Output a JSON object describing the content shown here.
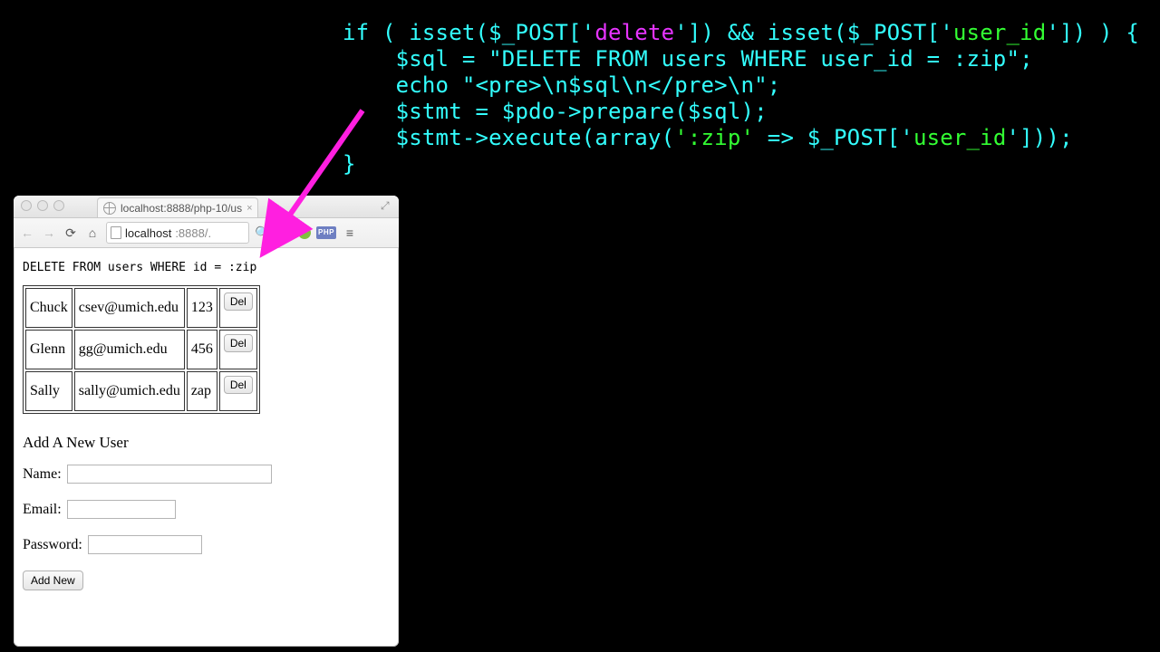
{
  "code": {
    "line1_pre": "if ( isset($_POST['",
    "line1_del": "delete",
    "line1_mid": "']) && isset($_POST['",
    "line1_uid": "user_id",
    "line1_post": "']) ) {",
    "line2": "    $sql = \"DELETE FROM users WHERE user_id = :zip\";",
    "line3": "    echo \"<pre>\\n$sql\\n</pre>\\n\";",
    "line4": "    $stmt = $pdo->prepare($sql);",
    "line5_pre": "    $stmt->execute(array(",
    "line5_zip": "':zip'",
    "line5_mid": " => $_POST['",
    "line5_uid": "user_id",
    "line5_post": "']));",
    "line6": "}"
  },
  "browser": {
    "tab_title": "localhost:8888/php-10/us",
    "address_host": "localhost",
    "address_port": ":8888/.",
    "php_badge": "PHP"
  },
  "page": {
    "sql_echo": "DELETE FROM users WHERE id = :zip",
    "users": [
      {
        "name": "Chuck",
        "email": "csev@umich.edu",
        "pw": "123"
      },
      {
        "name": "Glenn",
        "email": "gg@umich.edu",
        "pw": "456"
      },
      {
        "name": "Sally",
        "email": "sally@umich.edu",
        "pw": "zap"
      }
    ],
    "del_label": "Del",
    "section_head": "Add A New User",
    "labels": {
      "name": "Name:",
      "email": "Email:",
      "password": "Password:"
    },
    "add_label": "Add New"
  }
}
